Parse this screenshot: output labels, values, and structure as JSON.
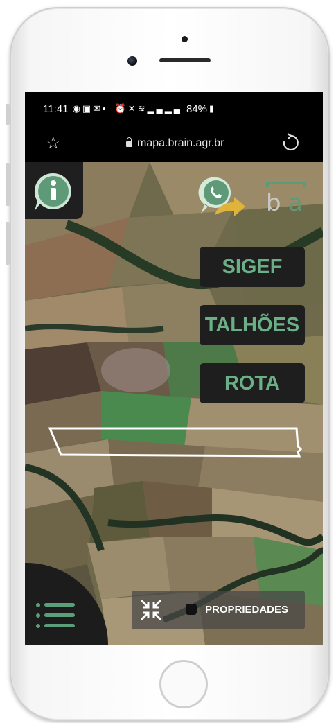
{
  "status_bar": {
    "time": "11:41",
    "notification_icons": [
      "whatsapp-icon",
      "linkedin-icon",
      "gmail-icon",
      "dot-icon"
    ],
    "system_icons": [
      "alarm-icon",
      "mute-icon",
      "wifi-icon",
      "signal-icon",
      "signal-icon"
    ],
    "battery": "84%"
  },
  "browser": {
    "url": "mapa.brain.agr.br"
  },
  "map": {
    "buttons": {
      "sigef": "SIGEF",
      "talhoes": "TALHÕES",
      "rota": "ROTA"
    },
    "toolbar": {
      "layer_label": "PROPRIEDADES"
    },
    "logo": {
      "left_letter": "b",
      "right_letter": "a"
    },
    "accent_color": "#6aaf86"
  }
}
